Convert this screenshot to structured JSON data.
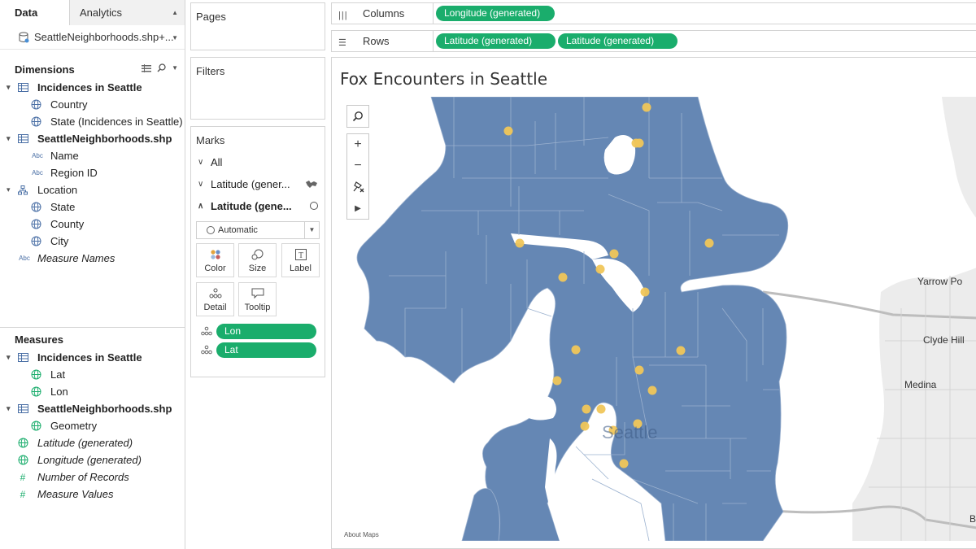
{
  "data_pane": {
    "tabs": [
      {
        "label": "Data"
      },
      {
        "label": "Analytics"
      }
    ],
    "datasource": "SeattleNeighborhoods.shp+...",
    "dimensions": {
      "heading": "Dimensions",
      "items": [
        {
          "label": "Incidences in Seattle",
          "type": "table"
        },
        {
          "label": "Country",
          "type": "geo"
        },
        {
          "label": "State (Incidences in Seattle)",
          "type": "geo"
        },
        {
          "label": "SeattleNeighborhoods.shp",
          "type": "table"
        },
        {
          "label": "Name",
          "type": "abc"
        },
        {
          "label": "Region ID",
          "type": "abc"
        },
        {
          "label": "Location",
          "type": "hierarchy"
        },
        {
          "label": "State",
          "type": "geo"
        },
        {
          "label": "County",
          "type": "geo"
        },
        {
          "label": "City",
          "type": "geo"
        },
        {
          "label": "Measure Names",
          "type": "abc"
        }
      ]
    },
    "measures": {
      "heading": "Measures",
      "items": [
        {
          "label": "Incidences in Seattle",
          "type": "table"
        },
        {
          "label": "Lat",
          "type": "geo"
        },
        {
          "label": "Lon",
          "type": "geo"
        },
        {
          "label": "SeattleNeighborhoods.shp",
          "type": "table"
        },
        {
          "label": "Geometry",
          "type": "geo"
        },
        {
          "label": "Latitude (generated)",
          "type": "geo"
        },
        {
          "label": "Longitude (generated)",
          "type": "geo"
        },
        {
          "label": "Number of Records",
          "type": "number"
        },
        {
          "label": "Measure Values",
          "type": "number"
        }
      ]
    }
  },
  "cards": {
    "pages": "Pages",
    "filters": "Filters",
    "marks": {
      "title": "Marks",
      "layers": [
        {
          "label": "All"
        },
        {
          "label": "Latitude (gener..."
        },
        {
          "label": "Latitude (gene..."
        }
      ],
      "mark_type": "Automatic",
      "buttons": {
        "color": "Color",
        "size": "Size",
        "label": "Label",
        "detail": "Detail",
        "tooltip": "Tooltip"
      },
      "fields": [
        {
          "label": "Lon"
        },
        {
          "label": "Lat"
        }
      ]
    }
  },
  "shelves": {
    "columns": {
      "label": "Columns",
      "pills": [
        "Longitude (generated)"
      ]
    },
    "rows": {
      "label": "Rows",
      "pills": [
        "Latitude (generated)",
        "Latitude (generated)"
      ]
    }
  },
  "view": {
    "title": "Fox Encounters in Seattle",
    "about_maps": "About Maps",
    "place_labels": {
      "seattle": "Seattle",
      "yarrow": "Yarrow Po",
      "clyde": "Clyde Hill",
      "medina": "Medina",
      "b": "B"
    },
    "colors": {
      "polygon": "#6587b4",
      "point": "#f0c65a",
      "pill": "#1aad6c",
      "water": "#ffffff",
      "land_bg": "#ececec"
    }
  }
}
